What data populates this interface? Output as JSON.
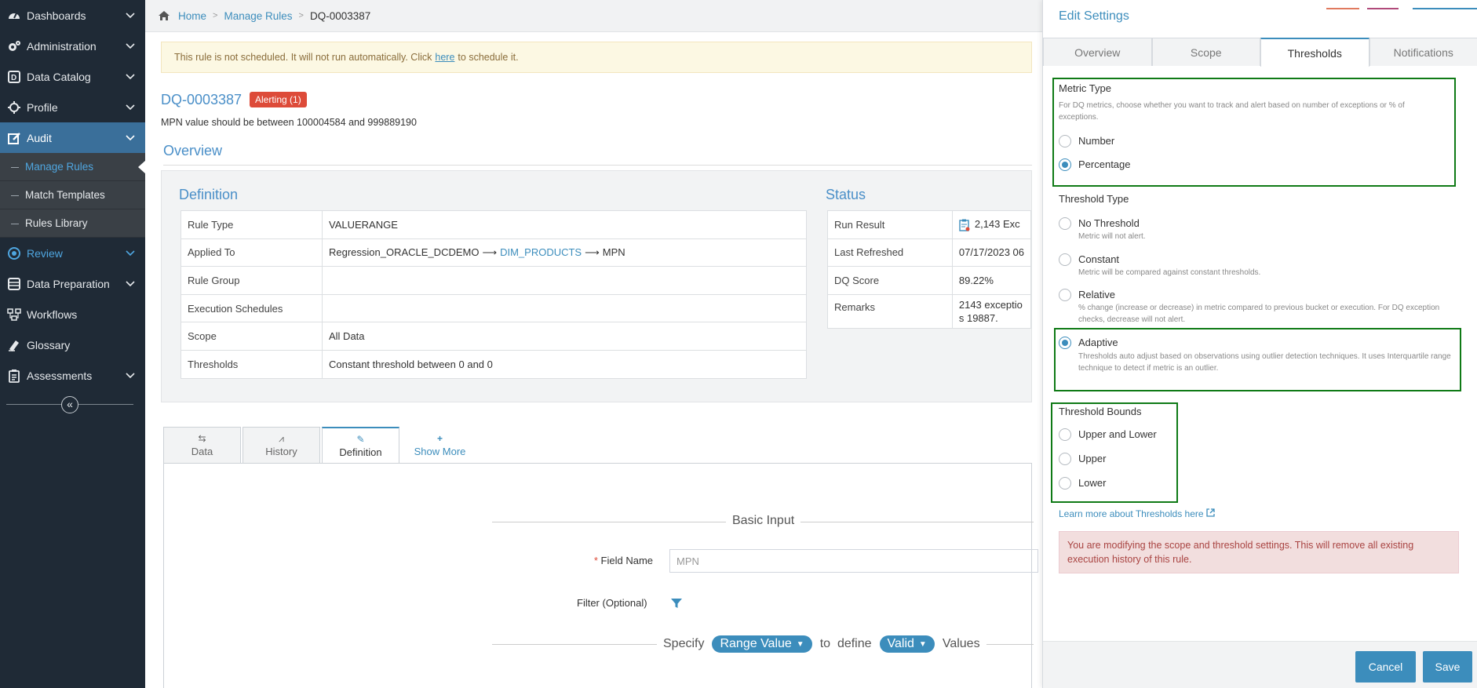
{
  "sidebar": {
    "items": [
      {
        "label": "Dashboards"
      },
      {
        "label": "Administration"
      },
      {
        "label": "Data Catalog"
      },
      {
        "label": "Profile"
      },
      {
        "label": "Audit"
      },
      {
        "label": "Review"
      },
      {
        "label": "Data Preparation"
      },
      {
        "label": "Workflows"
      },
      {
        "label": "Glossary"
      },
      {
        "label": "Assessments"
      }
    ],
    "audit_sub": [
      "Manage Rules",
      "Match Templates",
      "Rules Library"
    ]
  },
  "breadcrumb": {
    "home": "Home",
    "manage_rules": "Manage Rules",
    "current": "DQ-0003387"
  },
  "alert": {
    "before": "This rule is not scheduled. It will not run automatically. Click",
    "link": "here",
    "after": "to schedule it."
  },
  "rule": {
    "id": "DQ-0003387",
    "badge": "Alerting (1)",
    "description": "MPN value should be between 100004584 and 999889190"
  },
  "overview_title": "Overview",
  "definition": {
    "title": "Definition",
    "rows": [
      {
        "key": "Rule Type",
        "value": "VALUERANGE"
      },
      {
        "key": "Applied To",
        "source": "Regression_ORACLE_DCDEMO",
        "table": "DIM_PRODUCTS",
        "column": "MPN"
      },
      {
        "key": "Rule Group",
        "value": ""
      },
      {
        "key": "Execution Schedules",
        "value": ""
      },
      {
        "key": "Scope",
        "value": "All Data"
      },
      {
        "key": "Thresholds",
        "value": "Constant threshold between 0 and 0"
      }
    ]
  },
  "status": {
    "title": "Status",
    "rows": [
      {
        "key": "Run Result",
        "value": "2,143 Exc"
      },
      {
        "key": "Last Refreshed",
        "value": "07/17/2023 06"
      },
      {
        "key": "DQ Score",
        "value": "89.22%"
      },
      {
        "key": "Remarks",
        "line1": "2143 exceptio",
        "line2": "s 19887."
      }
    ]
  },
  "lower_tabs": [
    {
      "label": "Data"
    },
    {
      "label": "History"
    },
    {
      "label": "Definition"
    },
    {
      "label": "Show More"
    }
  ],
  "form": {
    "basic_input": "Basic Input",
    "field_name_label": "Field Name",
    "field_name_value": "MPN",
    "filter_label": "Filter (Optional)",
    "specify": "Specify",
    "range_value": "Range Value",
    "to_define": "to  define",
    "valid": "Valid",
    "values": "Values"
  },
  "panel": {
    "title": "Edit Settings",
    "tabs": [
      "Overview",
      "Scope",
      "Thresholds",
      "Notifications"
    ],
    "metric_type": {
      "title": "Metric Type",
      "help": "For DQ metrics, choose whether you want to track and alert based on number of exceptions or % of exceptions.",
      "options": [
        "Number",
        "Percentage"
      ],
      "selected": "Percentage"
    },
    "threshold_type": {
      "title": "Threshold Type",
      "options": [
        {
          "label": "No Threshold",
          "help": "Metric will not alert."
        },
        {
          "label": "Constant",
          "help": "Metric will be compared against constant thresholds."
        },
        {
          "label": "Relative",
          "help": "% change (increase or decrease) in metric compared to previous bucket or execution. For DQ exception checks, decrease will not alert."
        },
        {
          "label": "Adaptive",
          "help": "Thresholds auto adjust based on observations using outlier detection techniques. It uses Interquartile range technique to detect if metric is an outlier."
        }
      ],
      "selected": "Adaptive"
    },
    "threshold_bounds": {
      "title": "Threshold Bounds",
      "options": [
        "Upper and Lower",
        "Upper",
        "Lower"
      ]
    },
    "learn_more": "Learn more about Thresholds here",
    "warning": "You are modifying the scope and threshold settings. This will remove all existing execution history of this rule.",
    "cancel": "Cancel",
    "save": "Save"
  },
  "colors": {
    "sidebar_bg": "#1f2a36",
    "accent": "#3c8dbc",
    "highlight_box": "#0f7a16",
    "danger": "#dd4b39"
  }
}
